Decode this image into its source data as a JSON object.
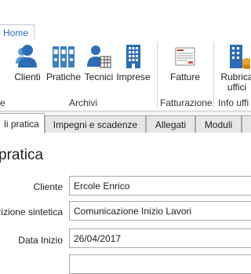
{
  "ribbon": {
    "home_tab": "Home",
    "buttons": {
      "clienti": "Clienti",
      "pratiche": "Pratiche",
      "tecnici": "Tecnici",
      "imprese": "Imprese",
      "fatture": "Fatture",
      "rubrica": "Rubrica\nuffici"
    },
    "groups": {
      "left_partial": "e",
      "archivi": "Archivi",
      "fatturazione": "Fatturazione",
      "info": "Info uffi"
    }
  },
  "tabs": [
    {
      "label": "li pratica",
      "active": true
    },
    {
      "label": "Impegni e scadenze",
      "active": false
    },
    {
      "label": "Allegati",
      "active": false
    },
    {
      "label": "Moduli",
      "active": false
    }
  ],
  "panel": {
    "title": "pratica",
    "fields": {
      "cliente": {
        "label": "Cliente",
        "value": "Ercole Enrico"
      },
      "descrizione": {
        "label": "rizione sintetica",
        "value": "Comunicazione Inizio Lavori"
      },
      "data_inizio": {
        "label": "Data Inizio",
        "value": "26/04/2017"
      }
    }
  },
  "colors": {
    "accent": "#2a6ebb",
    "icon_blue": "#3b7fc4",
    "icon_dark": "#2d5f96"
  }
}
